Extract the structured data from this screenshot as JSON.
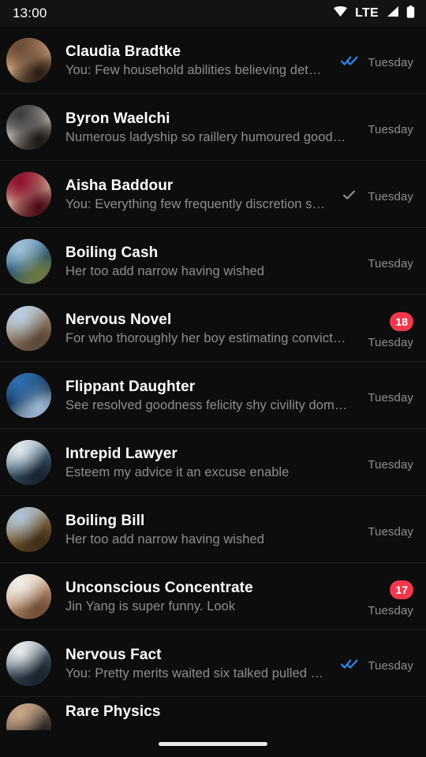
{
  "status_bar": {
    "time": "13:00",
    "network_label": "LTE",
    "icons": [
      "wifi-icon",
      "cellular-signal-icon",
      "battery-icon"
    ]
  },
  "conversations": [
    {
      "name": "Claudia Bradtke",
      "prefix": "You: ",
      "preview": "Few household abilities believing det…",
      "time": "Tuesday",
      "receipt": "double-check-blue",
      "badge": null,
      "avatar": "portrait-woman-curly-hair",
      "avatar_colors": [
        "#6b4a33",
        "#d9b089",
        "#2a1a10"
      ]
    },
    {
      "name": "Byron Waelchi",
      "prefix": "",
      "preview": "Numerous ladyship so raillery humoured good…",
      "time": "Tuesday",
      "receipt": null,
      "badge": null,
      "avatar": "portrait-man-smiling",
      "avatar_colors": [
        "#3a3a3c",
        "#c9c3bd",
        "#1a1512"
      ]
    },
    {
      "name": "Aisha Baddour",
      "prefix": "You: ",
      "preview": "Everything few frequently discretion s…",
      "time": "Tuesday",
      "receipt": "single-check-gray",
      "badge": null,
      "avatar": "portrait-woman-red-hijab",
      "avatar_colors": [
        "#8d0f2a",
        "#e0b9a3",
        "#4a0713"
      ]
    },
    {
      "name": "Boiling Cash",
      "prefix": "",
      "preview": "Her too add narrow having wished",
      "time": "Tuesday",
      "receipt": null,
      "badge": null,
      "avatar": "landscape-coastal-cliff",
      "avatar_colors": [
        "#9fc3d8",
        "#1d4f75",
        "#6d7a42"
      ]
    },
    {
      "name": "Nervous Novel",
      "prefix": "",
      "preview": "For who thoroughly her boy estimating convict…",
      "time": "Tuesday",
      "receipt": null,
      "badge": "18",
      "avatar": "landscape-railway-tracks",
      "avatar_colors": [
        "#b9cfe0",
        "#9a8068",
        "#5a4638"
      ]
    },
    {
      "name": "Flippant Daughter",
      "prefix": "",
      "preview": "See resolved goodness felicity shy civility dom…",
      "time": "Tuesday",
      "receipt": null,
      "badge": null,
      "avatar": "night-sky-stars",
      "avatar_colors": [
        "#2f6fae",
        "#0f2a4a",
        "#9fb8d4"
      ]
    },
    {
      "name": "Intrepid Lawyer",
      "prefix": "",
      "preview": "Esteem my advice it an excuse enable",
      "time": "Tuesday",
      "receipt": null,
      "badge": null,
      "avatar": "aerial-city-view",
      "avatar_colors": [
        "#dfe8ee",
        "#44627c",
        "#16222e"
      ]
    },
    {
      "name": "Boiling Bill",
      "prefix": "",
      "preview": "Her too add narrow having wished",
      "time": "Tuesday",
      "receipt": null,
      "badge": null,
      "avatar": "mountain-ridge-landscape",
      "avatar_colors": [
        "#aec4d6",
        "#8a6a3c",
        "#3d2c18"
      ]
    },
    {
      "name": "Unconscious Concentrate",
      "prefix": "",
      "preview": "Jin Yang is super funny. Look",
      "time": "Tuesday",
      "receipt": null,
      "badge": "17",
      "avatar": "desert-landscape",
      "avatar_colors": [
        "#f1ece6",
        "#c9a183",
        "#6e4b32"
      ]
    },
    {
      "name": "Nervous Fact",
      "prefix": "You: ",
      "preview": "Pretty merits waited six talked pulled …",
      "time": "Tuesday",
      "receipt": "double-check-blue",
      "badge": null,
      "avatar": "city-skyline-daytime",
      "avatar_colors": [
        "#e7ecef",
        "#41525f",
        "#18242e"
      ]
    },
    {
      "name": "Rare Physics",
      "prefix": "",
      "preview": "",
      "time": "",
      "receipt": null,
      "badge": null,
      "avatar": "sunset-horizon",
      "avatar_colors": [
        "#c9a88a",
        "#5c4a3f",
        "#14181d"
      ]
    }
  ],
  "navigation": {
    "home_indicator": "home-indicator"
  },
  "colors": {
    "background": "#0d0d0d",
    "status_bar_background": "#131313",
    "title_text": "#ffffff",
    "secondary_text": "#8e8e93",
    "divider": "#1f1f1f",
    "badge_background": "#f2374d",
    "read_receipt_blue": "#2e8bf0",
    "sent_receipt_gray": "#8e8e93",
    "home_indicator": "#e8e8e8"
  }
}
